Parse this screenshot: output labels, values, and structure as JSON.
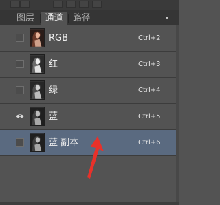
{
  "panel": {
    "tabs": [
      {
        "label": "图层",
        "active": false
      },
      {
        "label": "通道",
        "active": true
      },
      {
        "label": "路径",
        "active": false
      }
    ],
    "menu_icon": "panel-menu-icon"
  },
  "channels": [
    {
      "name": "RGB",
      "shortcut": "Ctrl+2",
      "visible": false,
      "selected": false
    },
    {
      "name": "红",
      "shortcut": "Ctrl+3",
      "visible": false,
      "selected": false
    },
    {
      "name": "绿",
      "shortcut": "Ctrl+4",
      "visible": false,
      "selected": false
    },
    {
      "name": "蓝",
      "shortcut": "Ctrl+5",
      "visible": true,
      "selected": false
    },
    {
      "name": "蓝 副本",
      "shortcut": "Ctrl+6",
      "visible": false,
      "selected": true
    }
  ],
  "colors": {
    "panel_bg": "#535353",
    "selected_row": "#5a6a80",
    "annotation_arrow": "#e8312a"
  }
}
